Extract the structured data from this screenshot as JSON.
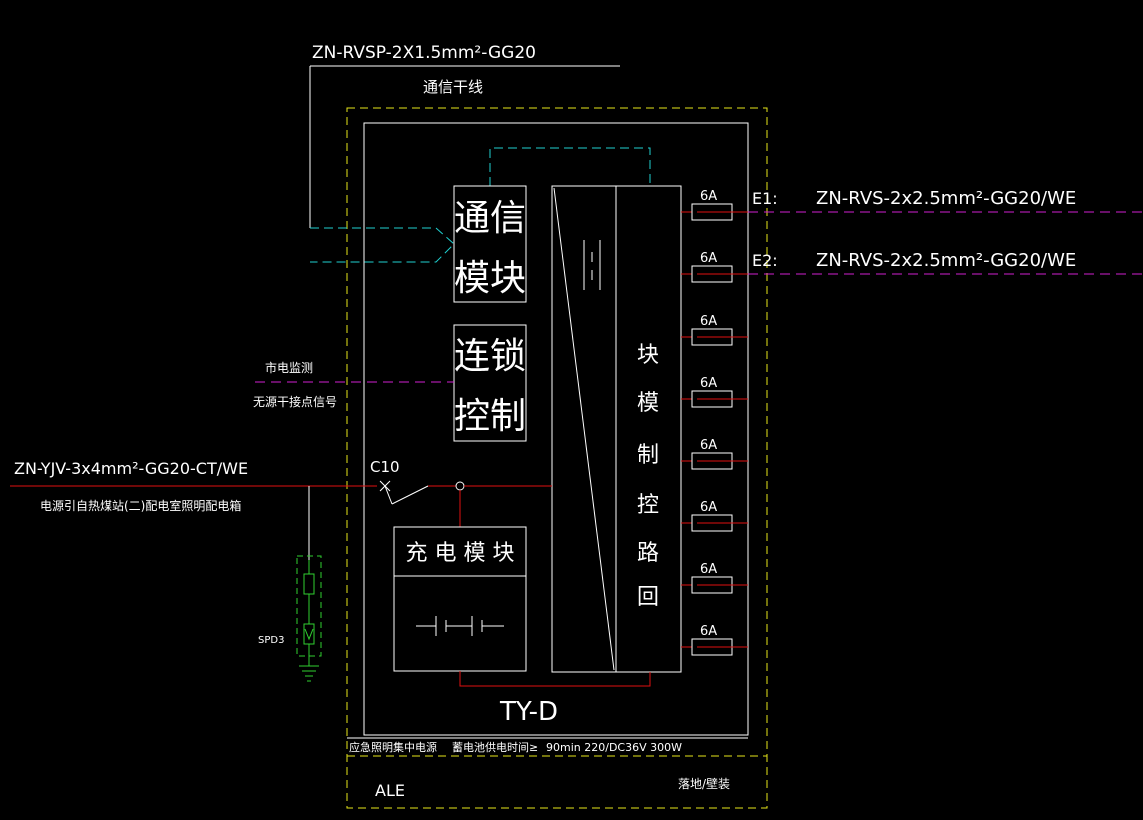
{
  "top_cable": {
    "spec": "ZN-RVSP-2X1.5mm²-GG20",
    "label": "通信干线"
  },
  "comm_module": {
    "line1": "通信",
    "line2": "模块"
  },
  "interlock": {
    "line1": "连锁",
    "line2": "控制"
  },
  "mains_monitor": {
    "line1": "市电监测",
    "line2": "无源干接点信号"
  },
  "power_in": {
    "spec": "ZN-YJV-3x4mm²-GG20-CT/WE",
    "desc": "电源引自热煤站(二)配电室照明配电箱"
  },
  "breaker": {
    "label": "C10"
  },
  "spd": {
    "label": "SPD3"
  },
  "charger": {
    "title": "充 电 模 块"
  },
  "loop_control": {
    "chars": [
      "块",
      "模",
      "制",
      "控",
      "路",
      "回"
    ]
  },
  "fuses": {
    "rating": "6A",
    "ratings": [
      "6A",
      "6A",
      "6A",
      "6A",
      "6A",
      "6A",
      "6A",
      "6A"
    ]
  },
  "outputs": [
    {
      "id": "E1:",
      "spec": "ZN-RVS-2x2.5mm²-GG20/WE"
    },
    {
      "id": "E2:",
      "spec": "ZN-RVS-2x2.5mm²-GG20/WE"
    }
  ],
  "panel_model": "TY-D",
  "footer": {
    "text1": "应急照明集中电源",
    "text2": "蓄电池供电时间≥",
    "text3": "90min 220/DC36V 300W",
    "box_id": "ALE",
    "mount": "落地/壁装"
  },
  "colors": {
    "background": "#000000",
    "frame": "#ffffff",
    "power": "#e01010",
    "comm": "#1fd0d0",
    "signal": "#d020d0",
    "enclosure": "#e6e61a",
    "ground": "#30d030"
  }
}
